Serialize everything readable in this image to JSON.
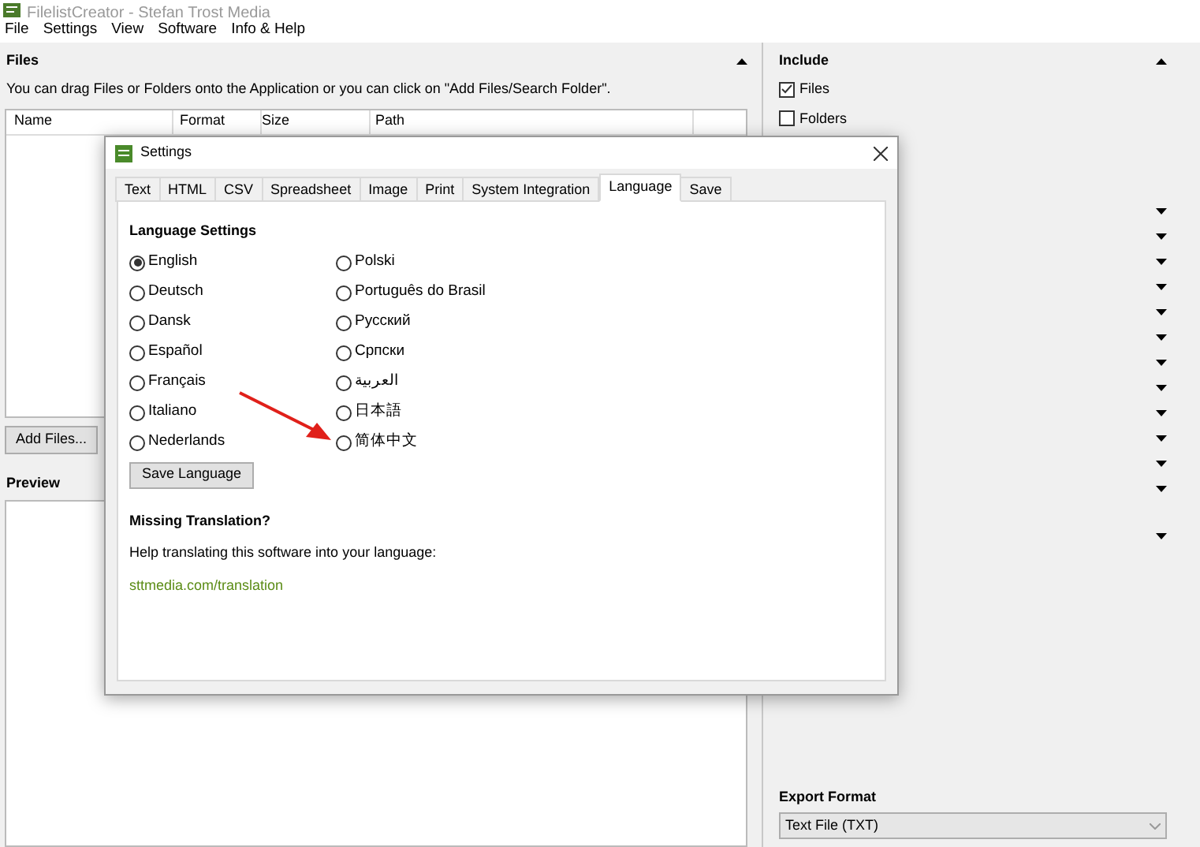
{
  "window": {
    "title": "FilelistCreator - Stefan Trost Media"
  },
  "menu": [
    "File",
    "Settings",
    "View",
    "Software",
    "Info & Help"
  ],
  "files": {
    "title": "Files",
    "hint": "You can drag Files or Folders onto the Application or you can click on \"Add Files/Search Folder\".",
    "columns": [
      "Name",
      "Format",
      "Size",
      "Path"
    ],
    "add_button": "Add Files..."
  },
  "preview": {
    "title": "Preview"
  },
  "include": {
    "title": "Include",
    "options": [
      {
        "label": "Files",
        "checked": true
      },
      {
        "label": "Folders",
        "checked": false
      }
    ]
  },
  "export_format": {
    "label": "Export Format",
    "value": "Text File (TXT)"
  },
  "dialog": {
    "title": "Settings",
    "tabs": [
      {
        "label": "Text",
        "selected": false
      },
      {
        "label": "HTML",
        "selected": false
      },
      {
        "label": "CSV",
        "selected": false
      },
      {
        "label": "Spreadsheet",
        "selected": false
      },
      {
        "label": "Image",
        "selected": false
      },
      {
        "label": "Print",
        "selected": false
      },
      {
        "label": "System Integration",
        "selected": false
      },
      {
        "label": "Language",
        "selected": true
      },
      {
        "label": "Save",
        "selected": false
      }
    ],
    "heading": "Language Settings",
    "languages": [
      {
        "label": "English",
        "selected": true
      },
      {
        "label": "Deutsch",
        "selected": false
      },
      {
        "label": "Dansk",
        "selected": false
      },
      {
        "label": "Español",
        "selected": false
      },
      {
        "label": "Français",
        "selected": false
      },
      {
        "label": "Italiano",
        "selected": false
      },
      {
        "label": "Nederlands",
        "selected": false
      },
      {
        "label": "Polski",
        "selected": false
      },
      {
        "label": "Português do Brasil",
        "selected": false
      },
      {
        "label": "Русский",
        "selected": false
      },
      {
        "label": "Српски",
        "selected": false
      },
      {
        "label": "العربية",
        "selected": false
      },
      {
        "label": "日本語",
        "selected": false
      },
      {
        "label": "简体中文",
        "selected": false
      }
    ],
    "save_button": "Save Language",
    "missing_heading": "Missing Translation?",
    "help_text": "Help translating this software into your language:",
    "link": "sttmedia.com/translation"
  }
}
